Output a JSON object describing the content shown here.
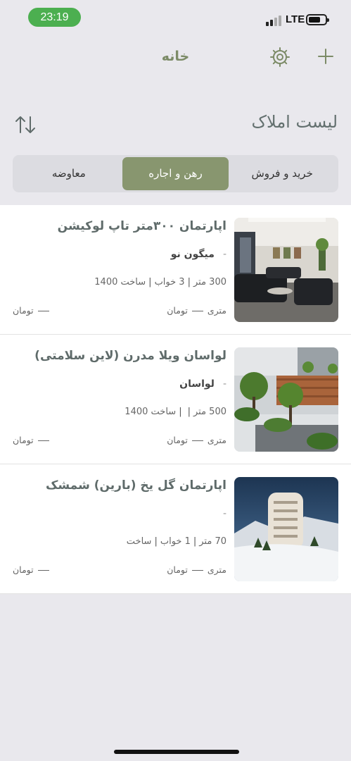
{
  "status_bar": {
    "time": "23:19",
    "network": "LTE"
  },
  "nav": {
    "title": "خانه"
  },
  "list_header": {
    "title": "لیست املاک"
  },
  "tabs": [
    {
      "label": "خرید و فروش",
      "active": false
    },
    {
      "label": "رهن و اجاره",
      "active": true
    },
    {
      "label": "معاوضه",
      "active": false
    }
  ],
  "colors": {
    "accent": "#88966f",
    "status_green": "#4caf50",
    "title_gray": "#63706f"
  },
  "properties": [
    {
      "title": "اپارتمان ۳۰۰متر تاپ لوکیشن",
      "location": "میگون نو",
      "area": "300",
      "area_unit": "متر",
      "bedrooms": "3 خواب",
      "built": "ساخت 1400",
      "per_meter": "متری",
      "price_unit_right": "تومان",
      "price_unit_left": "تومان",
      "image": "living-room-photo"
    },
    {
      "title": "لواسان ویلا مدرن (لاین سلامتی)",
      "location": "لواسان",
      "area": "500",
      "area_unit": "متر",
      "bedrooms": "",
      "built": "ساخت 1400",
      "per_meter": "متری",
      "price_unit_right": "تومان",
      "price_unit_left": "تومان",
      "image": "villa-garden-photo"
    },
    {
      "title": "اپارتمان گل یخ (بارین) شمشک",
      "location": "",
      "area": "70",
      "area_unit": "متر",
      "bedrooms": "1 خواب",
      "built": "ساخت",
      "per_meter": "متری",
      "price_unit_right": "تومان",
      "price_unit_left": "تومان",
      "image": "snowy-building-photo"
    }
  ]
}
